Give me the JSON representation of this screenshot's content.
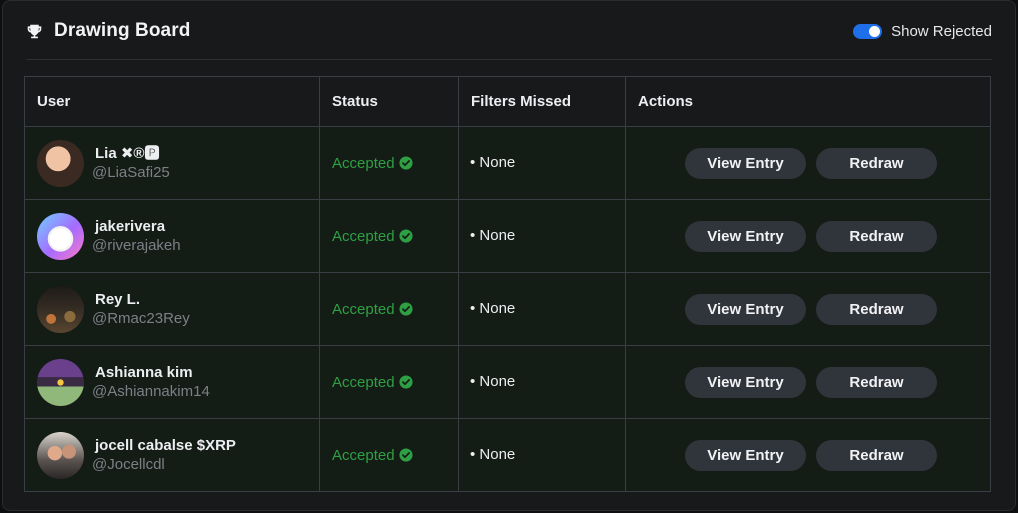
{
  "header": {
    "title": "Drawing Board",
    "icon": "trophy-icon",
    "toggle_label": "Show Rejected",
    "toggle_on": true
  },
  "table": {
    "columns": [
      "User",
      "Status",
      "Filters Missed",
      "Actions"
    ],
    "rows": [
      {
        "name": "Lia ✖®🅿",
        "handle": "@LiaSafi25",
        "status": "Accepted",
        "filters": "• None",
        "view_label": "View Entry",
        "redraw_label": "Redraw"
      },
      {
        "name": "jakerivera",
        "handle": "@riverajakeh",
        "status": "Accepted",
        "filters": "• None",
        "view_label": "View Entry",
        "redraw_label": "Redraw"
      },
      {
        "name": "Rey L.",
        "handle": "@Rmac23Rey",
        "status": "Accepted",
        "filters": "• None",
        "view_label": "View Entry",
        "redraw_label": "Redraw"
      },
      {
        "name": "Ashianna kim",
        "handle": "@Ashiannakim14",
        "status": "Accepted",
        "filters": "• None",
        "view_label": "View Entry",
        "redraw_label": "Redraw"
      },
      {
        "name": "jocell cabalse $XRP",
        "handle": "@Jocellcdl",
        "status": "Accepted",
        "filters": "• None",
        "view_label": "View Entry",
        "redraw_label": "Redraw"
      }
    ]
  },
  "colors": {
    "accent": "#1f6feb",
    "accepted": "#2ea043",
    "row_bg": "#141c16",
    "button_bg": "#30343b"
  }
}
